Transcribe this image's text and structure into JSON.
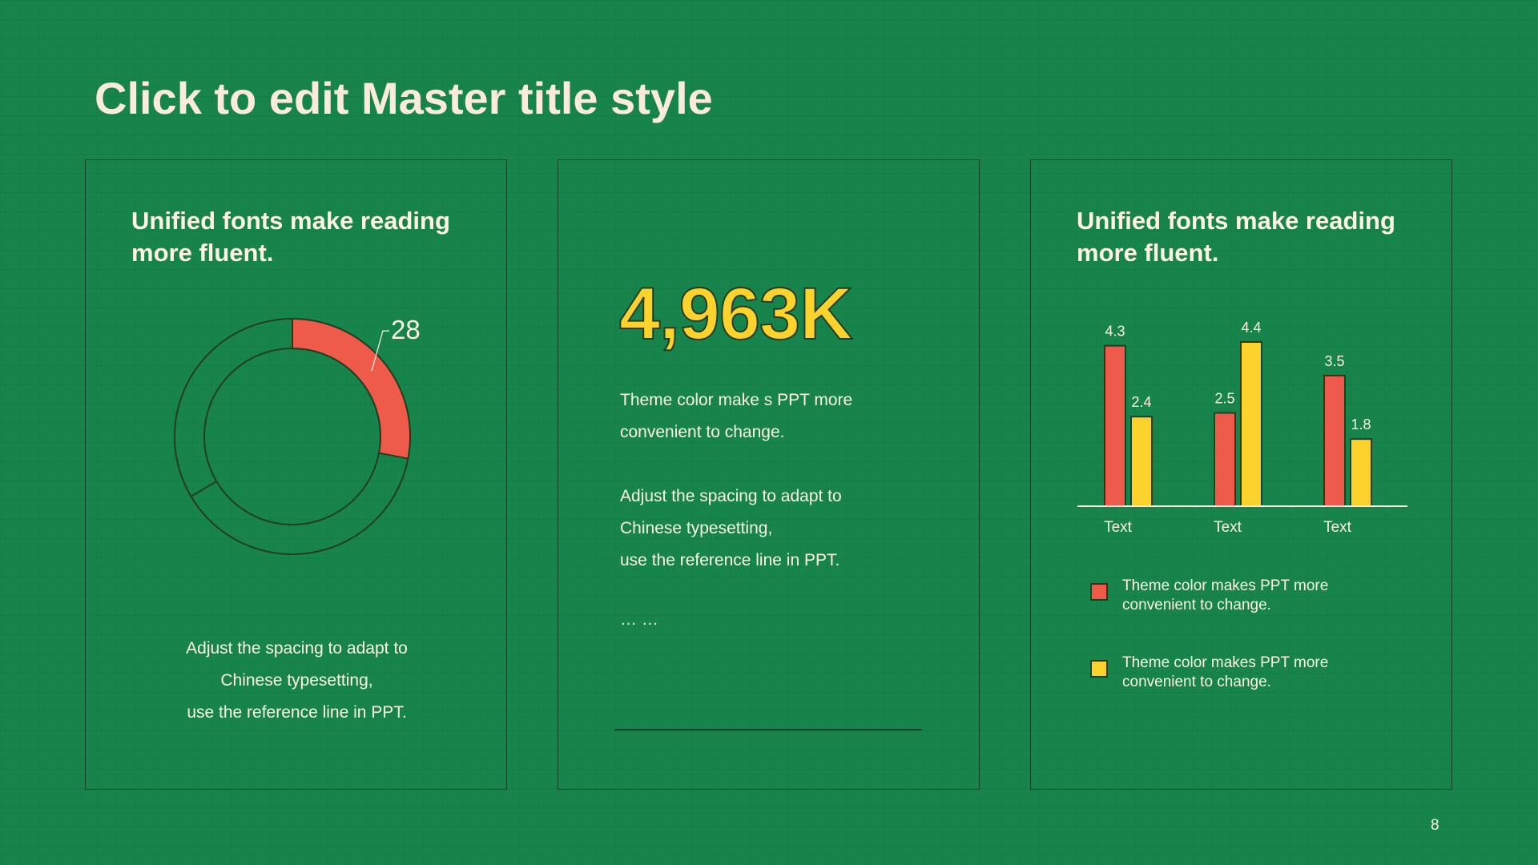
{
  "slide": {
    "title": "Click to edit Master title style",
    "page_number": "8"
  },
  "colors": {
    "background": "#17844b",
    "red": "#ef5b4b",
    "yellow": "#fcd22d",
    "text": "#fff4e4",
    "outline": "#243d1f"
  },
  "card1": {
    "heading": [
      "Unified fonts make reading",
      "more fluent."
    ],
    "body_lines": [
      "Adjust the spacing to adapt to",
      "Chinese typesetting,",
      "use the reference line in PPT."
    ]
  },
  "card2": {
    "big_number": "4,963K",
    "para1_lines": [
      "Theme  color make s PPT more",
      "convenient  to change."
    ],
    "para2_lines": [
      "Adjust the spacing to adapt to",
      "Chinese typesetting,",
      "use the reference line in PPT."
    ],
    "ellipsis": "… …"
  },
  "card3": {
    "heading": [
      "Unified fonts make reading",
      "more fluent."
    ],
    "legend": [
      {
        "lines": [
          "Theme  color makes PPT more",
          "convenient  to change."
        ],
        "color": "#ef5b4b"
      },
      {
        "lines": [
          "Theme  color makes PPT more",
          "convenient  to change."
        ],
        "color": "#fcd22d"
      }
    ]
  },
  "chart_data": [
    {
      "type": "pie",
      "variant": "donut",
      "highlighted_value": 28,
      "label": "28",
      "scale_max": 100,
      "colors": {
        "highlight": "#ef5b4b",
        "rest": "none"
      }
    },
    {
      "type": "bar",
      "categories": [
        "Text",
        "Text",
        "Text"
      ],
      "series": [
        {
          "values": [
            4.3,
            2.5,
            3.5
          ],
          "color": "#ef5b4b"
        },
        {
          "values": [
            2.4,
            4.4,
            1.8
          ],
          "color": "#fcd22d"
        }
      ],
      "data_labels": true,
      "ylim": [
        0,
        4.4
      ],
      "grid": false,
      "legend": "bottom"
    }
  ]
}
